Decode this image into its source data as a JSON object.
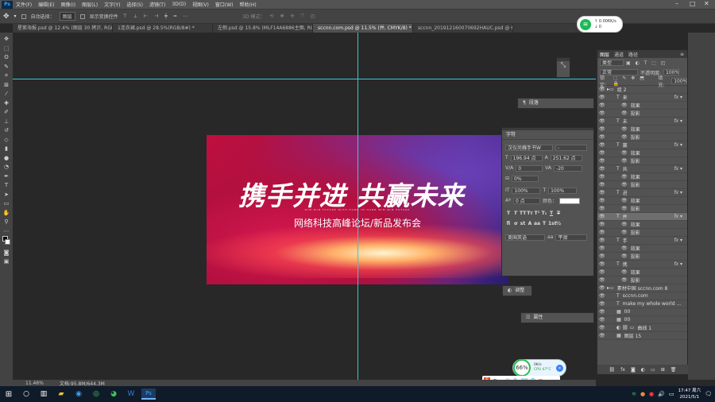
{
  "menubar": {
    "app": "Ps",
    "items": [
      "文件(F)",
      "编辑(E)",
      "图像(I)",
      "图层(L)",
      "文字(Y)",
      "选择(S)",
      "滤镜(T)",
      "3D(D)",
      "视图(V)",
      "窗口(W)",
      "帮助(H)"
    ]
  },
  "options": {
    "auto_select": "自动选择：",
    "auto_select_value": "图层",
    "show_transform": "显示变换控件",
    "mode3d": "3D 模式："
  },
  "tabs": [
    "星紫海报.psd @ 12.4% (图层 30 拷贝, RGB/8#) *",
    "1连衣裙.psd @ 28.5%(RGB/8#) *",
    "左侧.psd @ 15.8% (MLF14A6886主图, RGB/8#) *",
    "sccnn.com.psd @ 11.5% (并, CMYK/8) *",
    "sccnn_20191216007069​2HAUC.psd @ 68.3%(RGB/8#) *"
  ],
  "banner": {
    "headline": "携手并进 共赢未来",
    "subtitle": "网络科技高峰论坛/新品发布会",
    "small": "WIN-WIN FUTURE WITH HAND IN HAND WIN-WIN FUTURE"
  },
  "char_panel": {
    "title": "字符",
    "font": "汉仪尚巍手书W",
    "font_style": "-",
    "size": "196.94 点",
    "leading": "251.62 点",
    "kerning": "0",
    "tracking": "-20",
    "scale_pct": "0%",
    "vscale": "100%",
    "hscale": "100%",
    "baseline": "0 点",
    "color_label": "颜色：",
    "language": "美国英语",
    "aa": "平滑",
    "aa_label": "aa"
  },
  "mini_panels": {
    "paragraph": "段落",
    "adjust": "调整",
    "properties": "属性"
  },
  "layers": {
    "tabs": [
      "图层",
      "通道",
      "路径"
    ],
    "kind": "类型",
    "mode": "正常",
    "opacity_label": "不透明度:",
    "opacity": "100%",
    "lock_label": "锁定:",
    "fill_label": "填充:",
    "fill": "100%",
    "rows": [
      {
        "name": "组 2",
        "type": "group",
        "fx": false,
        "sel": false
      },
      {
        "name": "来",
        "type": "text",
        "fx": true,
        "sel": false
      },
      {
        "name": "效果",
        "type": "effect",
        "fx": false,
        "sel": false
      },
      {
        "name": "投影",
        "type": "effect",
        "fx": false,
        "sel": false
      },
      {
        "name": "未",
        "type": "text",
        "fx": true,
        "sel": false
      },
      {
        "name": "效果",
        "type": "effect",
        "fx": false,
        "sel": false
      },
      {
        "name": "投影",
        "type": "effect",
        "fx": false,
        "sel": false
      },
      {
        "name": "赢",
        "type": "text",
        "fx": true,
        "sel": false
      },
      {
        "name": "效果",
        "type": "effect",
        "fx": false,
        "sel": false
      },
      {
        "name": "投影",
        "type": "effect",
        "fx": false,
        "sel": false
      },
      {
        "name": "共",
        "type": "text",
        "fx": true,
        "sel": false
      },
      {
        "name": "效果",
        "type": "effect",
        "fx": false,
        "sel": false
      },
      {
        "name": "投影",
        "type": "effect",
        "fx": false,
        "sel": false
      },
      {
        "name": "进",
        "type": "text",
        "fx": true,
        "sel": false
      },
      {
        "name": "效果",
        "type": "effect",
        "fx": false,
        "sel": false
      },
      {
        "name": "投影",
        "type": "effect",
        "fx": false,
        "sel": false
      },
      {
        "name": "并",
        "type": "text",
        "fx": true,
        "sel": true
      },
      {
        "name": "效果",
        "type": "effect",
        "fx": false,
        "sel": false
      },
      {
        "name": "投影",
        "type": "effect",
        "fx": false,
        "sel": false
      },
      {
        "name": "手",
        "type": "text",
        "fx": true,
        "sel": false
      },
      {
        "name": "效果",
        "type": "effect",
        "fx": false,
        "sel": false
      },
      {
        "name": "投影",
        "type": "effect",
        "fx": false,
        "sel": false
      },
      {
        "name": "携",
        "type": "text",
        "fx": true,
        "sel": false
      },
      {
        "name": "效果",
        "type": "effect",
        "fx": false,
        "sel": false
      },
      {
        "name": "投影",
        "type": "effect",
        "fx": false,
        "sel": false
      },
      {
        "name": "素材中国 sccnn.com 8",
        "type": "group",
        "fx": false,
        "sel": false
      },
      {
        "name": "sccnn.com",
        "type": "text",
        "fx": false,
        "sel": false
      },
      {
        "name": "make my whole world ...",
        "type": "text",
        "fx": false,
        "sel": false
      },
      {
        "name": "00",
        "type": "image",
        "fx": false,
        "sel": false
      },
      {
        "name": "00",
        "type": "image",
        "fx": false,
        "sel": false
      },
      {
        "name": "曲线 1",
        "type": "adjust",
        "fx": false,
        "sel": false
      },
      {
        "name": "图层 15",
        "type": "image",
        "fx": false,
        "sel": false
      }
    ]
  },
  "status": {
    "zoom": "11.46%",
    "doc": "文档:95.8M/644.3M"
  },
  "network": {
    "up": "0.006K/s",
    "down": "0"
  },
  "cpu": {
    "percent": "66%",
    "net": "0K/s",
    "temp": "CPU 47°C"
  },
  "ime": {
    "lang": "中"
  },
  "clock": {
    "time": "17:47 周六",
    "date": "2021/5/1"
  }
}
